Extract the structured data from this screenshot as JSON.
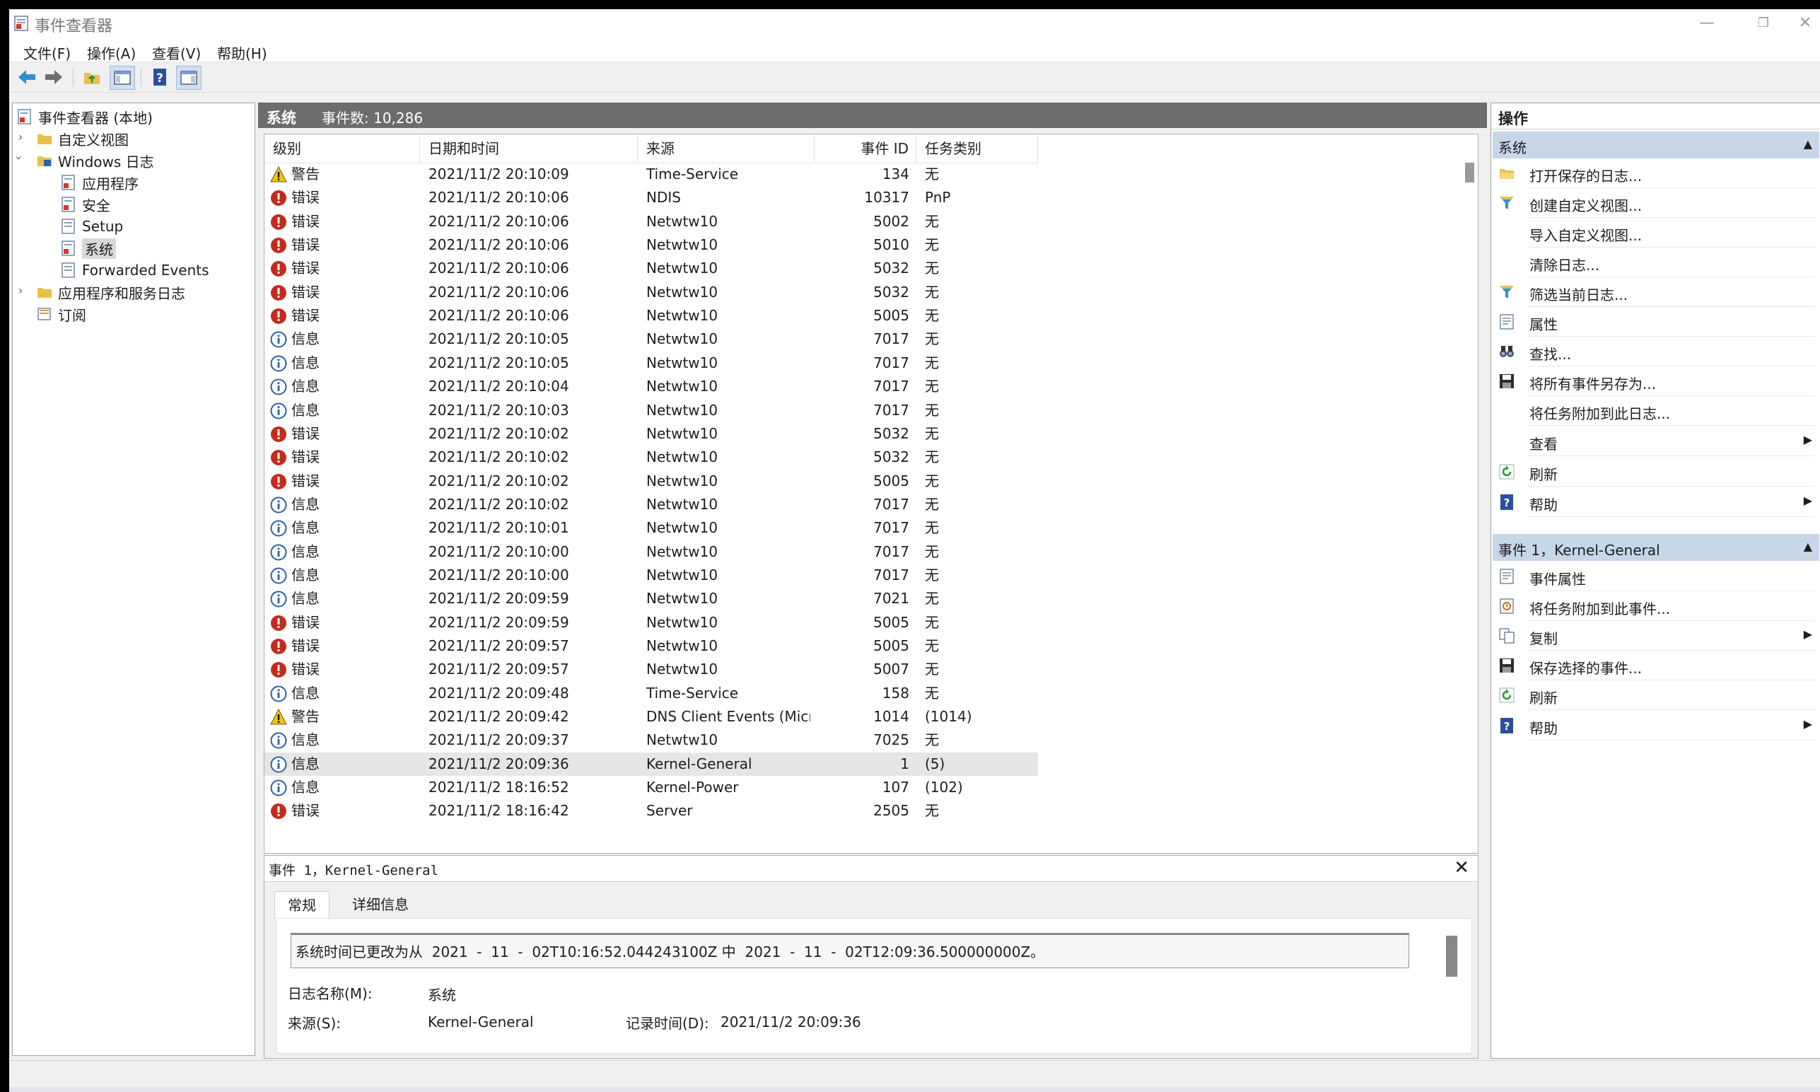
{
  "window": {
    "title": "事件查看器",
    "controls": [
      "—",
      "❐",
      "✕"
    ]
  },
  "menu": [
    "文件(F)",
    "操作(A)",
    "查看(V)",
    "帮助(H)"
  ],
  "toolbar": [
    "back-icon",
    "forward-icon",
    "up-folder-icon",
    "show-hide-tree-icon",
    "help-icon",
    "show-hide-action-pane-icon"
  ],
  "tree": {
    "root": "事件查看器 (本地)",
    "items": [
      "自定义视图",
      "Windows 日志",
      "应用程序",
      "安全",
      "Setup",
      "系统",
      "Forwarded Events",
      "应用程序和服务日志",
      "订阅"
    ]
  },
  "list": {
    "log_name": "系统",
    "count_label": "事件数: 10,286",
    "columns": [
      "级别",
      "日期和时间",
      "来源",
      "事件 ID",
      "任务类别"
    ],
    "rows": [
      {
        "level": "警告",
        "type": "warning",
        "date": "2021/11/2 20:10:09",
        "source": "Time-Service",
        "id": "134",
        "task": "无"
      },
      {
        "level": "错误",
        "type": "error",
        "date": "2021/11/2 20:10:06",
        "source": "NDIS",
        "id": "10317",
        "task": "PnP"
      },
      {
        "level": "错误",
        "type": "error",
        "date": "2021/11/2 20:10:06",
        "source": "Netwtw10",
        "id": "5002",
        "task": "无"
      },
      {
        "level": "错误",
        "type": "error",
        "date": "2021/11/2 20:10:06",
        "source": "Netwtw10",
        "id": "5010",
        "task": "无"
      },
      {
        "level": "错误",
        "type": "error",
        "date": "2021/11/2 20:10:06",
        "source": "Netwtw10",
        "id": "5032",
        "task": "无"
      },
      {
        "level": "错误",
        "type": "error",
        "date": "2021/11/2 20:10:06",
        "source": "Netwtw10",
        "id": "5032",
        "task": "无"
      },
      {
        "level": "错误",
        "type": "error",
        "date": "2021/11/2 20:10:06",
        "source": "Netwtw10",
        "id": "5005",
        "task": "无"
      },
      {
        "level": "信息",
        "type": "info",
        "date": "2021/11/2 20:10:05",
        "source": "Netwtw10",
        "id": "7017",
        "task": "无"
      },
      {
        "level": "信息",
        "type": "info",
        "date": "2021/11/2 20:10:05",
        "source": "Netwtw10",
        "id": "7017",
        "task": "无"
      },
      {
        "level": "信息",
        "type": "info",
        "date": "2021/11/2 20:10:04",
        "source": "Netwtw10",
        "id": "7017",
        "task": "无"
      },
      {
        "level": "信息",
        "type": "info",
        "date": "2021/11/2 20:10:03",
        "source": "Netwtw10",
        "id": "7017",
        "task": "无"
      },
      {
        "level": "错误",
        "type": "error",
        "date": "2021/11/2 20:10:02",
        "source": "Netwtw10",
        "id": "5032",
        "task": "无"
      },
      {
        "level": "错误",
        "type": "error",
        "date": "2021/11/2 20:10:02",
        "source": "Netwtw10",
        "id": "5032",
        "task": "无"
      },
      {
        "level": "错误",
        "type": "error",
        "date": "2021/11/2 20:10:02",
        "source": "Netwtw10",
        "id": "5005",
        "task": "无"
      },
      {
        "level": "信息",
        "type": "info",
        "date": "2021/11/2 20:10:02",
        "source": "Netwtw10",
        "id": "7017",
        "task": "无"
      },
      {
        "level": "信息",
        "type": "info",
        "date": "2021/11/2 20:10:01",
        "source": "Netwtw10",
        "id": "7017",
        "task": "无"
      },
      {
        "level": "信息",
        "type": "info",
        "date": "2021/11/2 20:10:00",
        "source": "Netwtw10",
        "id": "7017",
        "task": "无"
      },
      {
        "level": "信息",
        "type": "info",
        "date": "2021/11/2 20:10:00",
        "source": "Netwtw10",
        "id": "7017",
        "task": "无"
      },
      {
        "level": "信息",
        "type": "info",
        "date": "2021/11/2 20:09:59",
        "source": "Netwtw10",
        "id": "7021",
        "task": "无"
      },
      {
        "level": "错误",
        "type": "error",
        "date": "2021/11/2 20:09:59",
        "source": "Netwtw10",
        "id": "5005",
        "task": "无"
      },
      {
        "level": "错误",
        "type": "error",
        "date": "2021/11/2 20:09:57",
        "source": "Netwtw10",
        "id": "5005",
        "task": "无"
      },
      {
        "level": "错误",
        "type": "error",
        "date": "2021/11/2 20:09:57",
        "source": "Netwtw10",
        "id": "5007",
        "task": "无"
      },
      {
        "level": "信息",
        "type": "info",
        "date": "2021/11/2 20:09:48",
        "source": "Time-Service",
        "id": "158",
        "task": "无"
      },
      {
        "level": "警告",
        "type": "warning",
        "date": "2021/11/2 20:09:42",
        "source": "DNS Client Events (Micr...",
        "id": "1014",
        "task": "(1014)"
      },
      {
        "level": "信息",
        "type": "info",
        "date": "2021/11/2 20:09:37",
        "source": "Netwtw10",
        "id": "7025",
        "task": "无"
      },
      {
        "level": "信息",
        "type": "info",
        "date": "2021/11/2 20:09:36",
        "source": "Kernel-General",
        "id": "1",
        "task": "(5)",
        "selected": true
      },
      {
        "level": "信息",
        "type": "info",
        "date": "2021/11/2 18:16:52",
        "source": "Kernel-Power",
        "id": "107",
        "task": "(102)"
      },
      {
        "level": "错误",
        "type": "error",
        "date": "2021/11/2 18:16:42",
        "source": "Server",
        "id": "2505",
        "task": "无"
      }
    ]
  },
  "detail": {
    "title": "事件 1，Kernel-General",
    "close": "✕",
    "tabs": [
      "常规",
      "详细信息"
    ],
    "message": "系统时间已更改为从  2021  -  11  -  02T10:16:52.044243100Z 中  2021  -  11  -  02T12:09:36.500000000Z。",
    "log_label": "日志名称(M):",
    "log_value": "系统",
    "source_label": "来源(S):",
    "source_value": "Kernel-General",
    "recorded_label": "记录时间(D):",
    "recorded_value": "2021/11/2 20:09:36"
  },
  "actions": {
    "header": "操作",
    "section1": {
      "title": "系统",
      "items": [
        {
          "label": "打开保存的日志...",
          "icon": "open-folder-icon"
        },
        {
          "label": "创建自定义视图...",
          "icon": "filter-icon"
        },
        {
          "label": "导入自定义视图...",
          "icon": ""
        },
        {
          "label": "清除日志...",
          "icon": ""
        },
        {
          "label": "筛选当前日志...",
          "icon": "filter-icon"
        },
        {
          "label": "属性",
          "icon": "properties-icon"
        },
        {
          "label": "查找...",
          "icon": "binoculars-icon"
        },
        {
          "label": "将所有事件另存为...",
          "icon": "save-icon"
        },
        {
          "label": "将任务附加到此日志...",
          "icon": ""
        },
        {
          "label": "查看",
          "icon": "",
          "submenu": true
        },
        {
          "label": "刷新",
          "icon": "refresh-icon"
        },
        {
          "label": "帮助",
          "icon": "help-icon",
          "submenu": true
        }
      ]
    },
    "section2": {
      "title": "事件 1，Kernel-General",
      "items": [
        {
          "label": "事件属性",
          "icon": "properties-icon"
        },
        {
          "label": "将任务附加到此事件...",
          "icon": "task-icon"
        },
        {
          "label": "复制",
          "icon": "copy-icon",
          "submenu": true
        },
        {
          "label": "保存选择的事件...",
          "icon": "save-icon"
        },
        {
          "label": "刷新",
          "icon": "refresh-icon"
        },
        {
          "label": "帮助",
          "icon": "help-icon",
          "submenu": true
        }
      ]
    }
  },
  "colors": {
    "section_bg": "#c7d7ea",
    "header_bg": "#6d6d6d",
    "error": "#c42b1c",
    "info": "#2b5fa8",
    "warning": "#f2c40f"
  }
}
